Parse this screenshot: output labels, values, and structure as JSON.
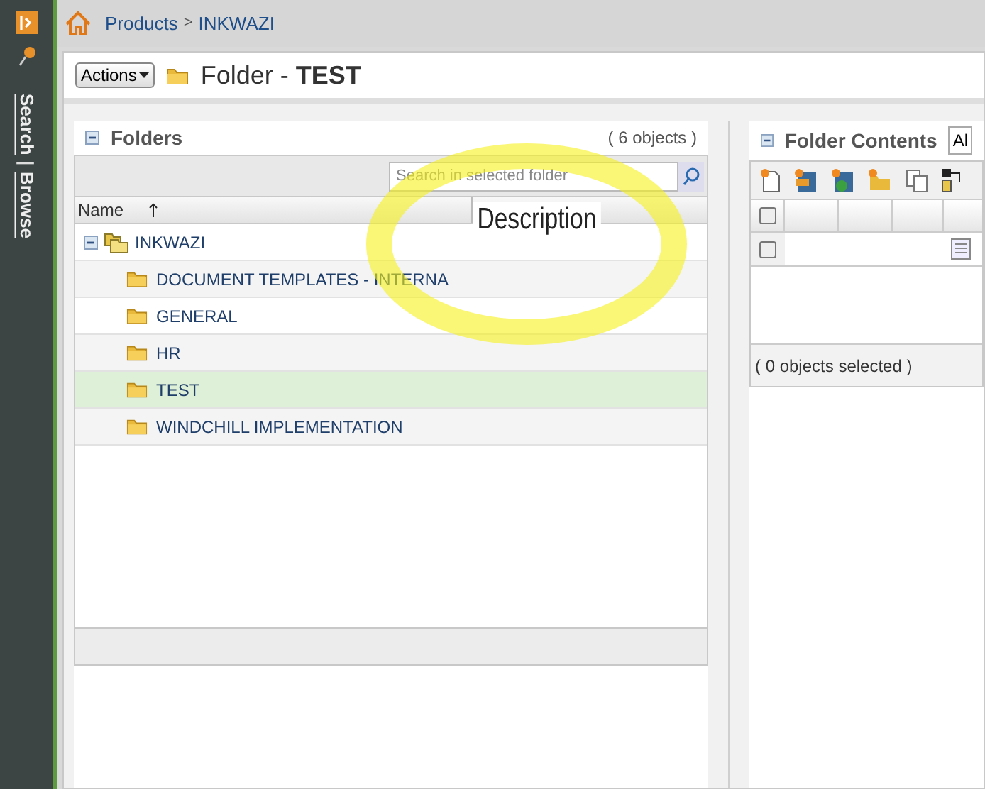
{
  "sidebar": {
    "labels": [
      "Search",
      "Browse"
    ],
    "separator": "|"
  },
  "breadcrumb": {
    "items": [
      "Products",
      "INKWAZI"
    ],
    "separator": ">"
  },
  "actions_button": {
    "label": "Actions"
  },
  "page_title": "Folder - **TEST**",
  "folders_panel": {
    "title": "Folders",
    "count": "( 6 objects )",
    "search": {
      "placeholder": "Search in selected folder"
    },
    "columns": [
      "Name"
    ],
    "tree": {
      "label": "INKWAZI",
      "expanded": true,
      "children": [
        {
          "label": "DOCUMENT TEMPLATES - INTERNA",
          "selected": false
        },
        {
          "label": "GENERAL",
          "selected": false
        },
        {
          "label": "HR",
          "selected": false
        },
        {
          "label": "TEST",
          "selected": true
        },
        {
          "label": "WINDCHILL IMPLEMENTATION",
          "selected": false
        }
      ]
    }
  },
  "annotation": {
    "label": "Description"
  },
  "contents_panel": {
    "title": "Folder Contents",
    "view_select": "Al",
    "header_checkbox": {
      "checked": false
    },
    "rows": [
      {
        "checked": false
      }
    ],
    "footer": "( 0 objects selected )"
  }
}
